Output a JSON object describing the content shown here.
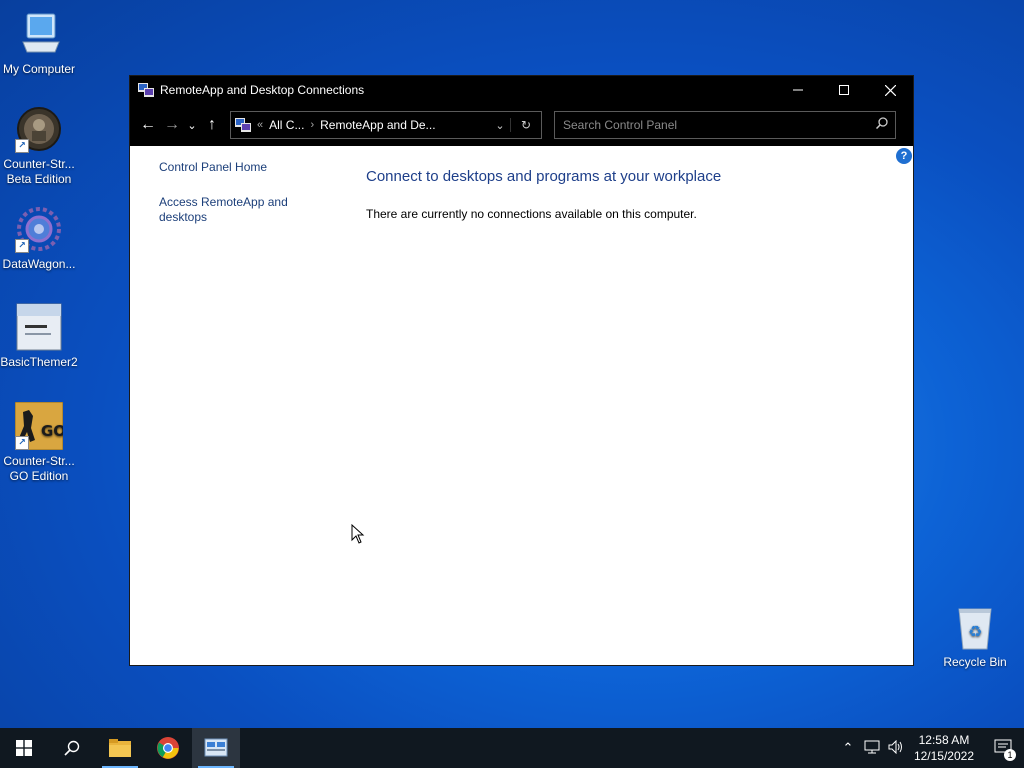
{
  "desktop": {
    "icons": [
      {
        "label": "My Computer"
      },
      {
        "label": "Counter-Str... Beta Edition"
      },
      {
        "label": "DataWagon..."
      },
      {
        "label": "BasicThemer2"
      },
      {
        "label": "Counter-Str... GO Edition"
      }
    ],
    "recycle_bin": "Recycle Bin"
  },
  "window": {
    "title": "RemoteApp and Desktop Connections",
    "address": {
      "crumb_1": "All C...",
      "crumb_2": "RemoteApp and De..."
    },
    "search_placeholder": "Search Control Panel",
    "left_pane": {
      "home": "Control Panel Home",
      "access": "Access RemoteApp and desktops"
    },
    "main": {
      "heading": "Connect to desktops and programs at your workplace",
      "message": "There are currently no connections available on this computer."
    },
    "help": "?"
  },
  "taskbar": {
    "time": "12:58 AM",
    "date": "12/15/2022",
    "notification_count": "1"
  }
}
